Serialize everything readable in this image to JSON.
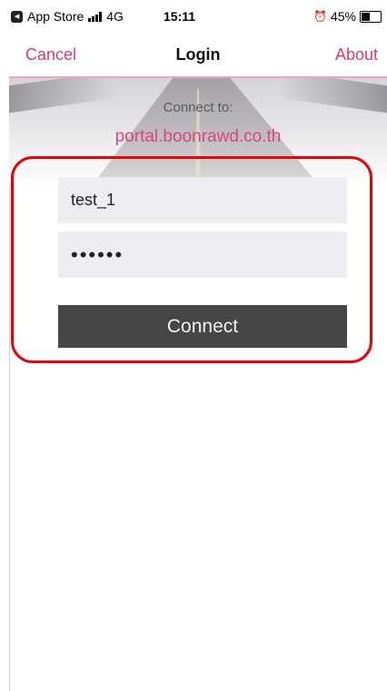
{
  "status_bar": {
    "carrier_label": "App Store",
    "network": "4G",
    "time": "15:11",
    "battery_percent": "45%",
    "battery_level": 0.45
  },
  "nav": {
    "cancel_label": "Cancel",
    "title": "Login",
    "about_label": "About"
  },
  "login": {
    "connect_to_label": "Connect to:",
    "server": "portal.boonrawd.co.th",
    "username_value": "test_1",
    "password_value": "••••••",
    "connect_label": "Connect"
  },
  "colors": {
    "accent": "#d83b75",
    "highlight": "#e8000b",
    "button_bg": "#464646"
  }
}
